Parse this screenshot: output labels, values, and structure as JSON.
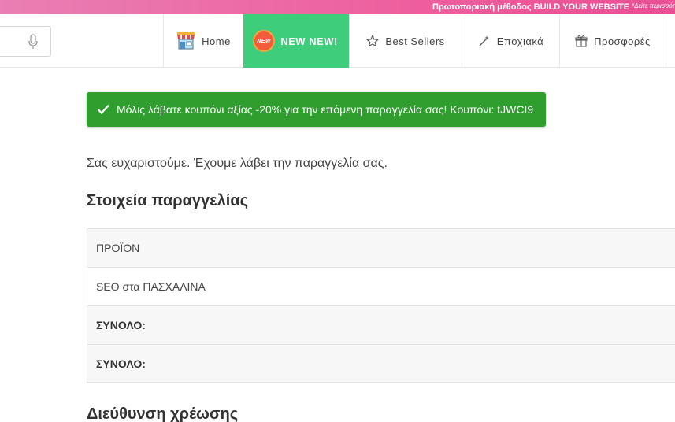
{
  "promo": {
    "text": "Πρωτοποριακή μέθοδος BUILD YOUR WEBSITE",
    "note": "*Δείτε περισσότ"
  },
  "nav": {
    "items": [
      {
        "label": "Home",
        "icon": "shop-icon"
      },
      {
        "label": "NEW NEW!",
        "icon": "new-badge-icon",
        "badge_text": "NEW"
      },
      {
        "label": "Best Sellers",
        "icon": "star-icon"
      },
      {
        "label": "Εποχιακά",
        "icon": "magic-wand-icon"
      },
      {
        "label": "Προσφορές",
        "icon": "gift-icon"
      }
    ]
  },
  "notice": {
    "text": "Μόλις λάβατε κουπόνι αξίας -20% για την επόμενη παραγγελία σας! Κουπόνι: tJWCI9"
  },
  "thanks": "Σας ευχαριστούμε. Έχουμε λάβει την παραγγελία σας.",
  "order_details": {
    "title": "Στοιχεία παραγγελίας",
    "header": "ΠΡΟΪΟΝ",
    "product": "SEO στα ΠΑΣΧΑΛΙΝΑ",
    "subtotal_label": "ΣΥΝΟΛΟ:",
    "total_label": "ΣΥΝΟΛΟ:"
  },
  "billing": {
    "title": "Διεύθυνση χρέωσης"
  },
  "colors": {
    "promo_pink": "#ee5f9e",
    "new_green": "#3dcd7b",
    "notice_green": "#2f9e2f"
  }
}
